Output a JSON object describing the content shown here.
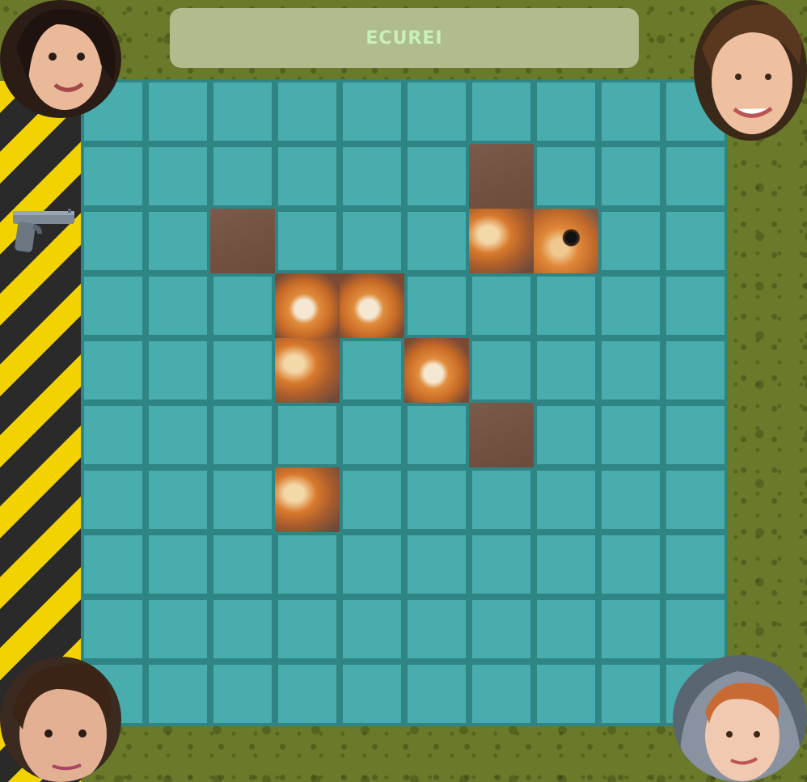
{
  "title": "ECUREI",
  "board": {
    "rows": 10,
    "cols": 10
  },
  "revealed_cells": [
    {
      "r": 1,
      "c": 6,
      "tex": "rev"
    },
    {
      "r": 2,
      "c": 2,
      "tex": "rev"
    },
    {
      "r": 2,
      "c": 6,
      "tex": "fur2"
    },
    {
      "r": 2,
      "c": 7,
      "tex": "eye"
    },
    {
      "r": 3,
      "c": 3,
      "tex": "fur"
    },
    {
      "r": 3,
      "c": 4,
      "tex": "fur"
    },
    {
      "r": 4,
      "c": 3,
      "tex": "fur2"
    },
    {
      "r": 4,
      "c": 5,
      "tex": "fur"
    },
    {
      "r": 5,
      "c": 6,
      "tex": "rev"
    },
    {
      "r": 6,
      "c": 3,
      "tex": "fur2"
    }
  ],
  "icons": {
    "weapon": "pistol-icon"
  },
  "colors": {
    "background": "#6b7a2a",
    "board": "#2f8583",
    "tile": "#49adae",
    "title_bar": "#b0bb8e",
    "title_text": "#c8f0b8",
    "hazard_yellow": "#f2d200",
    "hazard_black": "#2a2a2a"
  }
}
